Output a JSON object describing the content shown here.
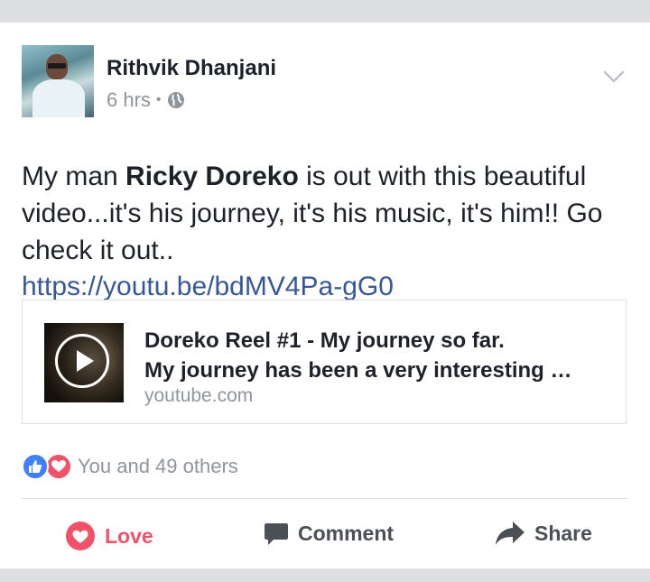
{
  "post": {
    "author": "Rithvik Dhanjani",
    "time": "6 hrs",
    "separator": "•",
    "text_before": "My man ",
    "text_bold": "Ricky Doreko",
    "text_after": " is out with this beautiful video...it's his journey, it's his music, it's him!! Go check it out..",
    "link": "https://youtu.be/bdMV4Pa-gG0"
  },
  "link_preview": {
    "title": "Doreko Reel #1 - My journey so far.",
    "description": "My journey has been a very interesting …",
    "domain": "youtube.com"
  },
  "reactions": {
    "summary": "You and 49 others"
  },
  "actions": {
    "love": "Love",
    "comment": "Comment",
    "share": "Share"
  },
  "colors": {
    "link": "#365899",
    "love": "#f25268",
    "like": "#4080ff",
    "muted": "#90949c"
  },
  "icons": [
    "globe-icon",
    "chevron-down-icon",
    "play-icon",
    "like-reaction-icon",
    "love-reaction-icon",
    "heart-icon",
    "comment-icon",
    "share-icon"
  ]
}
